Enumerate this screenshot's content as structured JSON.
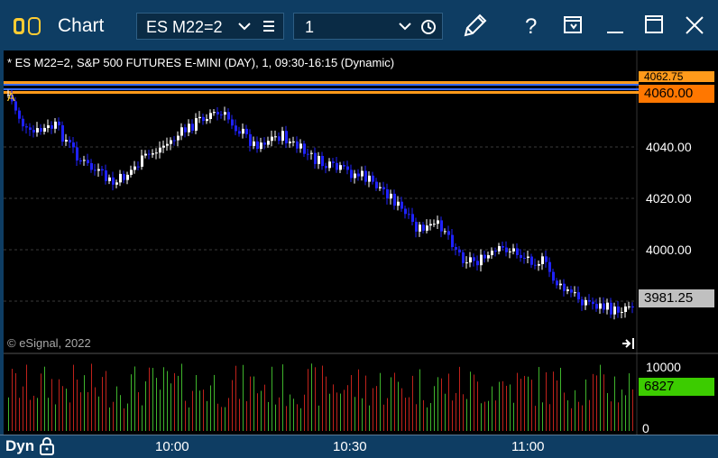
{
  "titlebar": {
    "title": "Chart",
    "symbol": "ES M22=2",
    "interval": "1",
    "icons": [
      "app-logo-icon",
      "chevron-down-icon",
      "menu-icon",
      "chevron-down-icon",
      "clock-icon",
      "pencil-icon",
      "help-icon",
      "window-icon",
      "minimize-icon",
      "maximize-icon",
      "close-icon"
    ]
  },
  "chart": {
    "info": "* ES M22=2, S&P 500 FUTURES E-MINI (DAY), 1, 09:30-16:15 (Dynamic)",
    "copyright": "© eSignal, 2022",
    "marker_label": "A",
    "price_axis": [
      "4040.00",
      "4020.00",
      "4000.00"
    ],
    "last_price": "3981.25",
    "orange_tag": "4060.00",
    "partial_tag": "4062.75",
    "volume_axis": [
      "10000",
      "0"
    ],
    "volume_last": "6827"
  },
  "bottombar": {
    "label": "Dyn",
    "times": [
      "10:00",
      "10:30",
      "11:00"
    ]
  },
  "colors": {
    "up_candle": "#ffffff",
    "down_candle": "#1f22ff",
    "volume_up": "#3fb52c",
    "volume_down": "#c0221b",
    "orange": "#ff7700",
    "green": "#3ccc00"
  }
}
